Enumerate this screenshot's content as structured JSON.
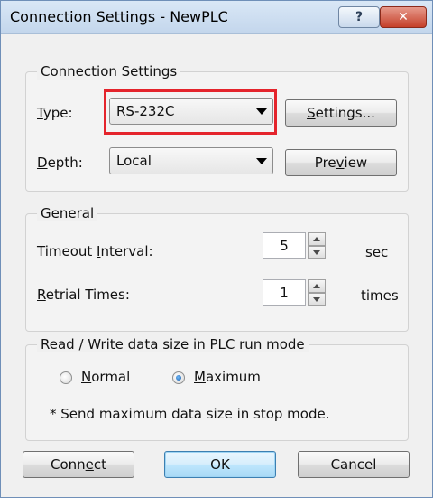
{
  "window": {
    "title": "Connection Settings - NewPLC",
    "help_label": "?",
    "close_label": "✕"
  },
  "connection": {
    "legend": "Connection Settings",
    "type_label": "Type:",
    "type_value": "RS-232C",
    "settings_button": "Settings...",
    "depth_label": "Depth:",
    "depth_value": "Local",
    "preview_button": "Preview"
  },
  "general": {
    "legend": "General",
    "timeout_label": "Timeout Interval:",
    "timeout_value": "5",
    "timeout_unit": "sec",
    "retrial_label": "Retrial Times:",
    "retrial_value": "1",
    "retrial_unit": "times"
  },
  "rw": {
    "legend": "Read / Write data size in PLC run mode",
    "normal_label": "Normal",
    "maximum_label": "Maximum",
    "selected": "Maximum",
    "note": "* Send maximum data size in stop mode."
  },
  "buttons": {
    "connect": "Connect",
    "ok": "OK",
    "cancel": "Cancel"
  },
  "colors": {
    "highlight": "#e4242c",
    "title_bar": "#c3d6ec",
    "close": "#c5402a"
  }
}
